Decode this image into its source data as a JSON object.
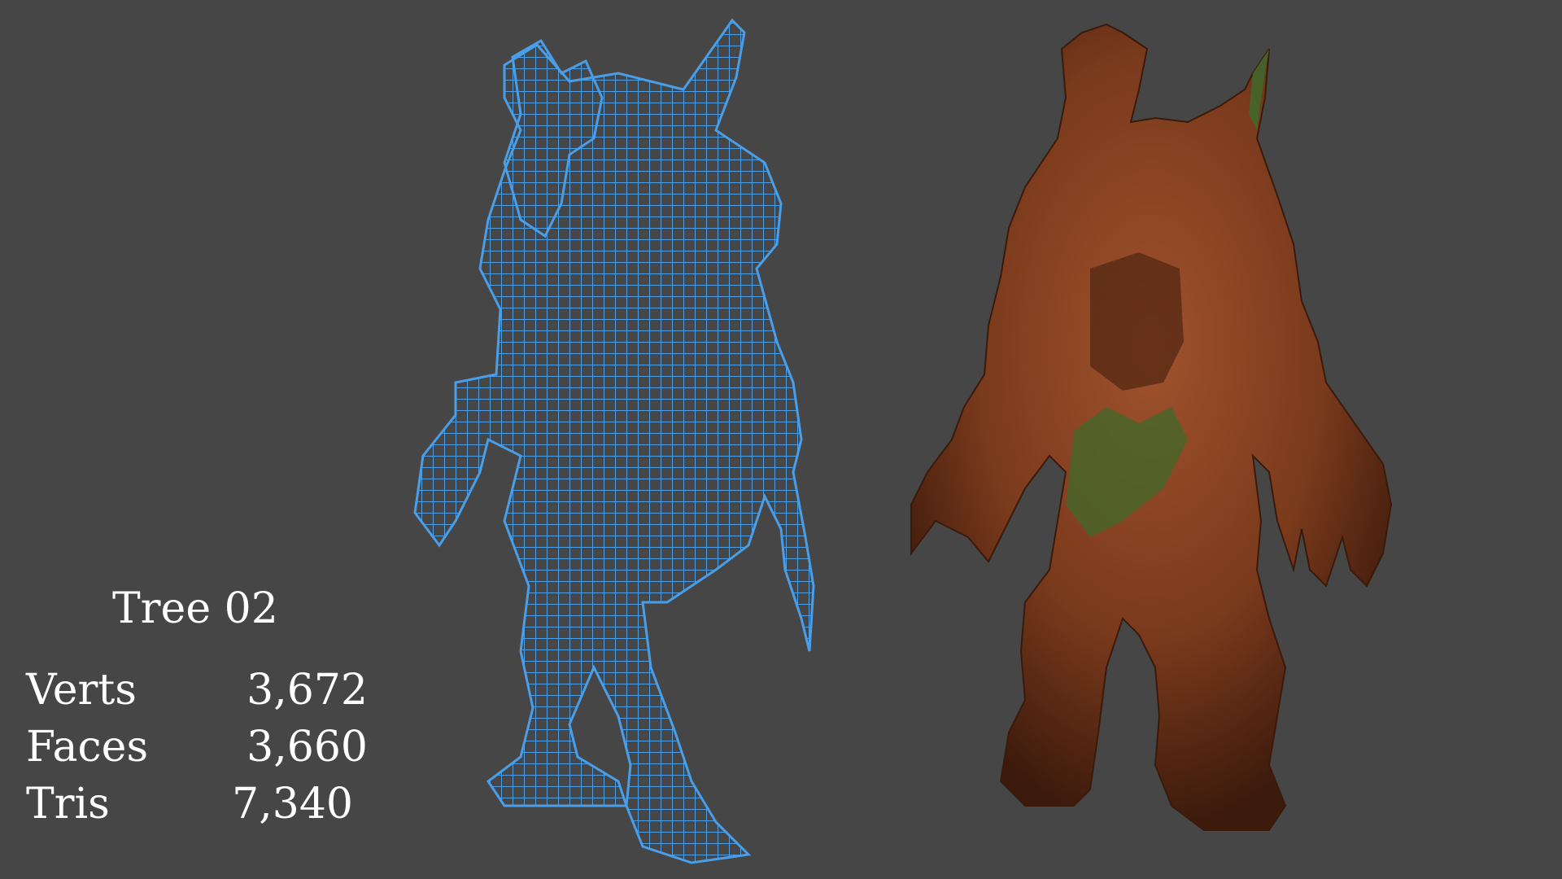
{
  "model": {
    "name": "Tree 02",
    "stats": [
      {
        "label": "Verts",
        "value": "3,672"
      },
      {
        "label": "Faces",
        "value": "3,660"
      },
      {
        "label": "Tris",
        "value": "7,340"
      }
    ]
  },
  "colors": {
    "background": "#464646",
    "wireframe": "#4a9ee8",
    "bark": "#7a3a1c",
    "moss": "#3f6a2a",
    "text": "#ffffff"
  }
}
